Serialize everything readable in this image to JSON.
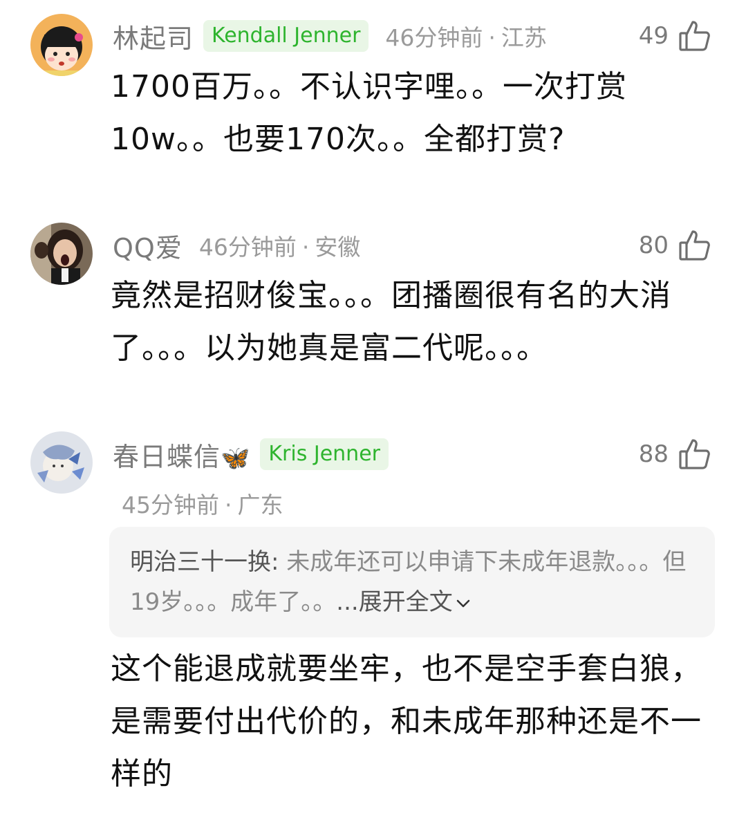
{
  "comments": [
    {
      "username": "林起司",
      "badge": "Kendall Jenner",
      "time": "46分钟前",
      "dot": "·",
      "location": "江苏",
      "likes": "49",
      "avatar_icon": "cartoon-girl-avatar",
      "text": "1700百万。。不认识字哩。。一次打赏10w。。也要170次。。全都打赏?"
    },
    {
      "username": "QQ爱",
      "time": "46分钟前",
      "dot": "·",
      "location": "安徽",
      "likes": "80",
      "avatar_icon": "woman-photo-avatar",
      "text": "竟然是招财俊宝。。。团播圈很有名的大消了。。。以为她真是富二代呢。。。"
    },
    {
      "username": "春日蝶信",
      "username_emoji": "🦋",
      "badge": "Kris Jenner",
      "time": "45分钟前",
      "dot": "·",
      "location": "广东",
      "likes": "88",
      "avatar_icon": "blue-butterfly-girl-avatar",
      "quote_author": "明治三十一换:",
      "quote_text": " 未成年还可以申请下未成年退款。。。但19岁。。。成年了。。",
      "expand_label": "...展开全文",
      "text": "这个能退成就要坐牢，也不是空手套白狼，是需要付出代价的，和未成年那种还是不一样的"
    }
  ],
  "colors": {
    "badge_bg": "#e9f6e6",
    "badge_text": "#2eb42e",
    "meta_text": "#9a9a9a",
    "quote_bg": "#f5f5f5"
  }
}
